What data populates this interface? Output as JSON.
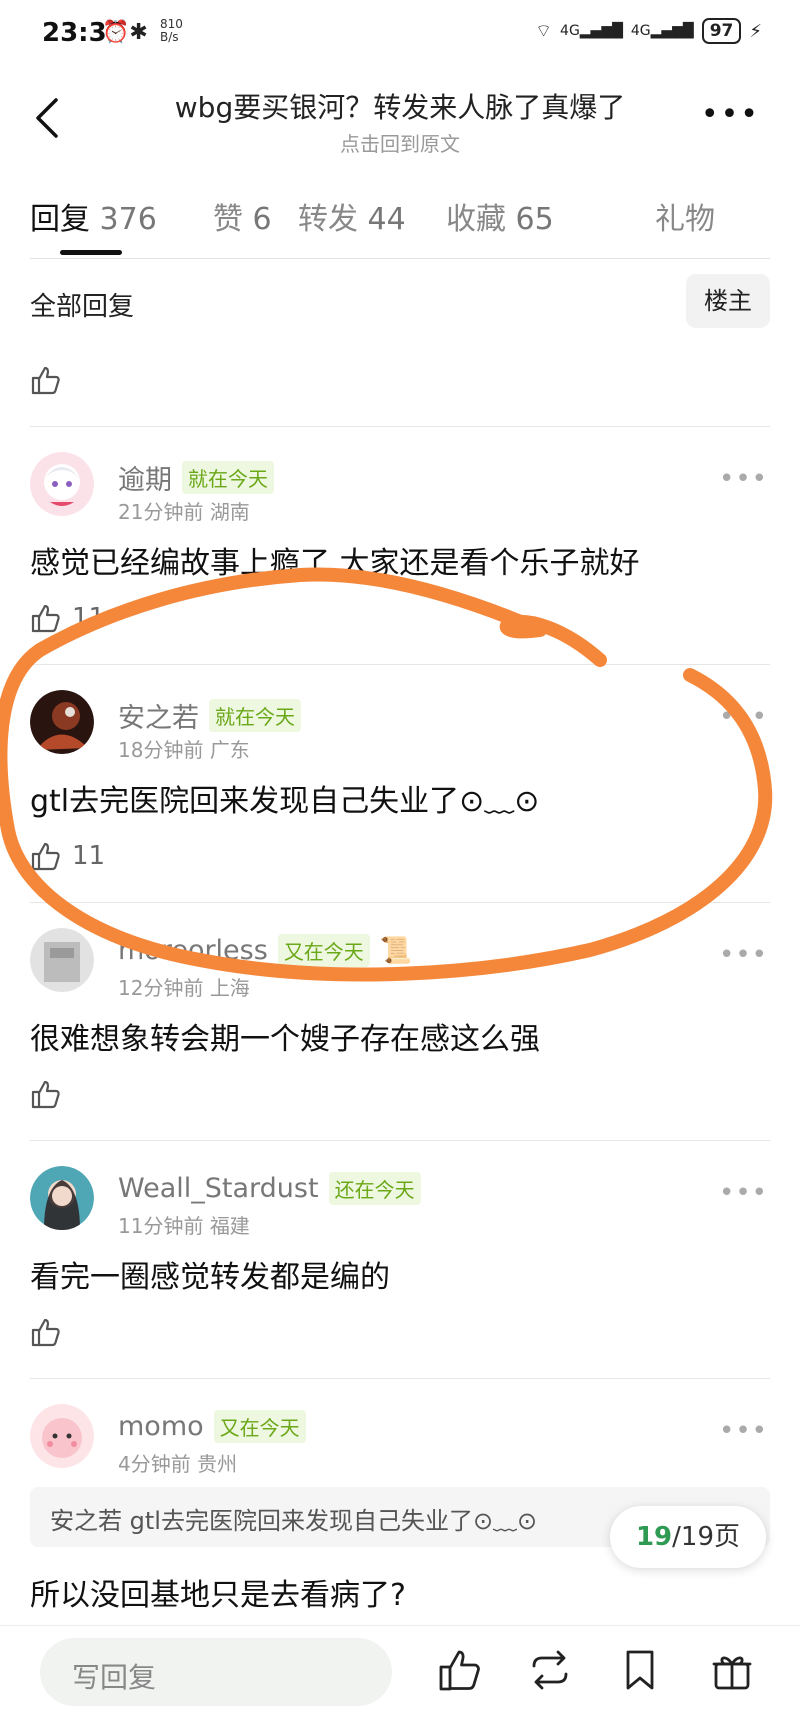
{
  "status_bar": {
    "time": "23:33",
    "net_speed_value": "810",
    "net_speed_unit": "B/s",
    "battery": "97"
  },
  "nav": {
    "title": "wbg要买银河？转发来人脉了真爆了",
    "subtitle": "点击回到原文"
  },
  "tabs": [
    {
      "label": "回复",
      "count": "376"
    },
    {
      "label": "赞",
      "count": "6"
    },
    {
      "label": "转发",
      "count": "44"
    },
    {
      "label": "收藏",
      "count": "65"
    },
    {
      "label": "礼物",
      "count": ""
    }
  ],
  "filter": {
    "all_label": "全部回复",
    "owner_label": "楼主"
  },
  "comments": [
    {
      "username": "逾期",
      "badge": "就在今天",
      "time": "21分钟前",
      "location": "湖南",
      "text": "感觉已经编故事上瘾了 大家还是看个乐子就好",
      "likes": "11",
      "avatar_color": "#f4c8d6"
    },
    {
      "username": "安之若",
      "badge": "就在今天",
      "time": "18分钟前",
      "location": "广东",
      "text": "gtl去完医院回来发现自己失业了⊙﹏⊙",
      "likes": "11",
      "avatar_color": "#5a2a1a"
    },
    {
      "username": "moreorless",
      "badge": "又在今天",
      "time": "12分钟前",
      "location": "上海",
      "text": "很难想象转会期一个嫂子存在感这么强",
      "likes": "",
      "avatar_color": "#cfcfcf"
    },
    {
      "username": "Weall_Stardust",
      "badge": "还在今天",
      "time": "11分钟前",
      "location": "福建",
      "text": "看完一圈感觉转发都是编的",
      "likes": "",
      "avatar_color": "#3d7a8a"
    },
    {
      "username": "momo",
      "badge": "又在今天",
      "time": "4分钟前",
      "location": "贵州",
      "quote_user": "安之若",
      "quote_text": "gtl去完医院回来发现自己失业了⊙﹏⊙",
      "text": "所以没回基地只是去看病了?",
      "likes": "",
      "avatar_color": "#f7d3d8"
    }
  ],
  "top_like": "",
  "page_indicator": {
    "current": "19",
    "total": "/19页"
  },
  "bottom_bar": {
    "reply_placeholder": "写回复"
  },
  "colors": {
    "badge_green": "#6aa817",
    "page_current": "#2e9a54",
    "annotation_orange": "#f5873a"
  }
}
